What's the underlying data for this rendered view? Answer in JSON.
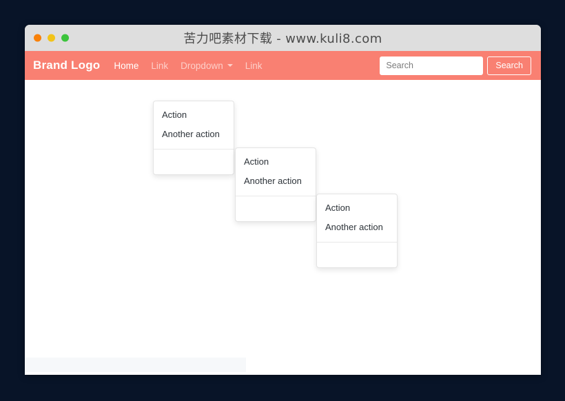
{
  "window": {
    "title": "苦力吧素材下载 - www.kuli8.com",
    "traffic_lights": [
      "close",
      "minimize",
      "maximize"
    ]
  },
  "navbar": {
    "brand": "Brand Logo",
    "links": [
      {
        "label": "Home",
        "active": true,
        "has_caret": false
      },
      {
        "label": "Link",
        "active": false,
        "has_caret": false
      },
      {
        "label": "Dropdown",
        "active": false,
        "has_caret": true
      },
      {
        "label": "Link",
        "active": false,
        "has_caret": false
      }
    ],
    "search": {
      "placeholder": "Search",
      "value": "",
      "button_label": "Search"
    },
    "background_color": "#f98072"
  },
  "dropdowns": [
    {
      "id": "menu-1",
      "items": [
        "Action",
        "Another action"
      ]
    },
    {
      "id": "menu-2",
      "items": [
        "Action",
        "Another action"
      ]
    },
    {
      "id": "menu-3",
      "items": [
        "Action",
        "Another action"
      ]
    }
  ],
  "colors": {
    "page_background": "#081428",
    "titlebar": "#dedede",
    "accent": "#f98072",
    "content": "#ffffff",
    "footer": "#f6f8fa"
  }
}
